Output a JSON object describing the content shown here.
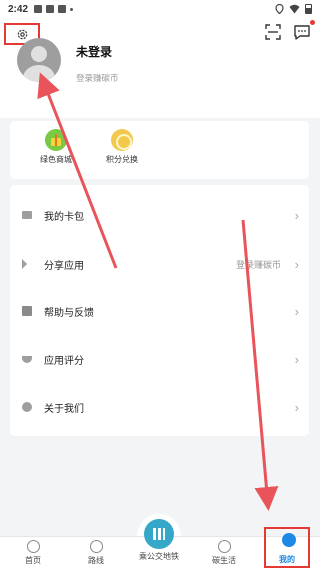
{
  "status_bar": {
    "time": "2:42"
  },
  "profile": {
    "name": "未登录",
    "login_hint": "登录赚碳币"
  },
  "quick_actions": [
    {
      "label": "绿色商城",
      "icon": "gift-icon"
    },
    {
      "label": "积分兑换",
      "icon": "coin-icon"
    }
  ],
  "menu": [
    {
      "label": "我的卡包",
      "hint": "",
      "icon": "wallet-icon"
    },
    {
      "label": "分享应用",
      "hint": "登录赚碳币",
      "icon": "share-icon"
    },
    {
      "label": "帮助与反馈",
      "hint": "",
      "icon": "help-icon"
    },
    {
      "label": "应用评分",
      "hint": "",
      "icon": "rate-icon"
    },
    {
      "label": "关于我们",
      "hint": "",
      "icon": "info-icon"
    }
  ],
  "bottom_nav": {
    "home": "首页",
    "route": "路线",
    "transit": "乘公交地铁",
    "carbon": "碳生活",
    "mine": "我的"
  },
  "colors": {
    "accent": "#1e88e5",
    "highlight": "#e53935",
    "transit": "#35a7c9"
  }
}
